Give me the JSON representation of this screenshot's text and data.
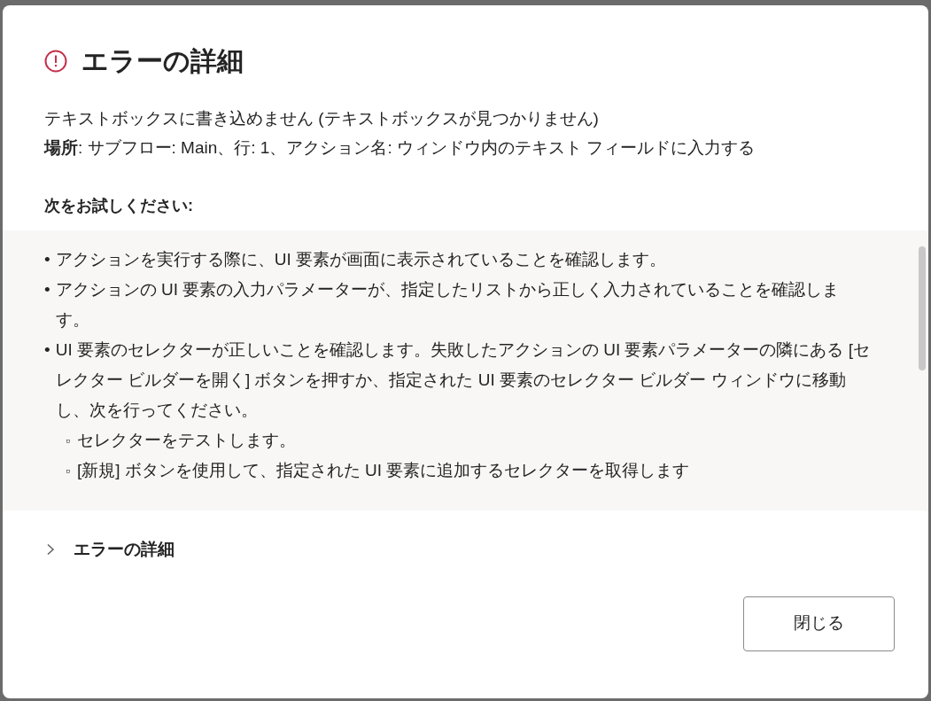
{
  "dialog": {
    "title": "エラーの詳細",
    "message": "テキストボックスに書き込めません (テキストボックスが見つかりません)",
    "location": "**場所**: サブフロー: Main、行: 1、アクション名: ウィンドウ内のテキスト フィールドに入力する",
    "suggestions_heading": "次をお試しください:",
    "suggestions": [
      {
        "kind": "bullet",
        "marker": "•",
        "text": "アクションを実行する際に、UI 要素が画面に表示されていることを確認します。"
      },
      {
        "kind": "bullet",
        "marker": "•",
        "text": "アクションの UI 要素の入力パラメーターが、指定したリストから正しく入力されていることを確認します。"
      },
      {
        "kind": "bullet",
        "marker": "•",
        "text": "UI 要素のセレクターが正しいことを確認します。失敗したアクションの UI 要素パラメーターの隣にある [セレクター ビルダーを開く] ボタンを押すか、指定された UI 要素のセレクター ビルダー ウィンドウに移動し、次を行ってください。"
      },
      {
        "kind": "sub",
        "marker": "▫",
        "text": "セレクターをテストします。"
      },
      {
        "kind": "sub",
        "marker": "▫",
        "text": "[新規] ボタンを使用して、指定された UI 要素に追加するセレクターを取得します"
      }
    ],
    "details": {
      "label": "エラーの詳細",
      "expanded": false
    },
    "buttons": [
      {
        "label": "閉じる"
      }
    ]
  }
}
